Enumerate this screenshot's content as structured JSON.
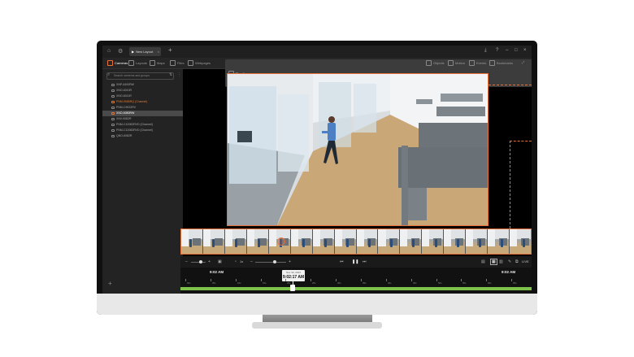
{
  "app": {
    "tab_title": "New Layout",
    "tab_close": "×",
    "new_tab": "+",
    "window_controls": [
      "⤓",
      "?",
      "–",
      "□",
      "×"
    ]
  },
  "nav": {
    "left": [
      {
        "label": "Cameras",
        "icon": "camera-icon",
        "active": true
      },
      {
        "label": "Layouts",
        "icon": "layout-icon"
      },
      {
        "label": "Maps",
        "icon": "map-icon"
      },
      {
        "label": "Files",
        "icon": "file-icon"
      },
      {
        "label": "Webpages",
        "icon": "webpage-icon"
      },
      {
        "label": "Timeline",
        "icon": "timeline-icon"
      }
    ],
    "right": [
      {
        "label": "Objects",
        "icon": "objects-icon"
      },
      {
        "label": "Motion",
        "icon": "motion-icon"
      },
      {
        "label": "Events",
        "icon": "events-icon"
      },
      {
        "label": "Bookmarks",
        "icon": "bookmark-icon"
      }
    ]
  },
  "sidebar": {
    "search_placeholder": "Search cameras and groups",
    "items": [
      {
        "label": "XNP-6400RW",
        "state": "normal"
      },
      {
        "label": "XNO-6010R",
        "state": "normal"
      },
      {
        "label": "XNO-6011R",
        "state": "normal"
      },
      {
        "label": "PNM-9085RQ (Channel)",
        "state": "warning"
      },
      {
        "label": "PNM-C9022RV",
        "state": "normal"
      },
      {
        "label": "XNO-6080RW",
        "state": "selected"
      },
      {
        "label": "XNV-9082R",
        "state": "normal"
      },
      {
        "label": "PNM-C12083RVD (Channel)",
        "state": "normal"
      },
      {
        "label": "PNM-C12083RVD (Channel)",
        "state": "normal"
      },
      {
        "label": "QNO-6082R",
        "state": "normal"
      }
    ]
  },
  "controls": {
    "speed": "1x",
    "zoom_out": "–",
    "zoom_in": "+",
    "live": "LIVE"
  },
  "timeline": {
    "left_time": "9:02 AM",
    "right_time": "9:02 AM",
    "cursor_date": "Nov 30, 2023",
    "cursor_time": "9:02:17 AM",
    "ticks": [
      "00s",
      "05s",
      "10s",
      "15s",
      "20s",
      "25s",
      "30s",
      "35s",
      "40s",
      "45s",
      "50s",
      "55s",
      "00s",
      "05s"
    ]
  },
  "colors": {
    "accent": "#e8703a",
    "timeline_green": "#7dc24a"
  }
}
